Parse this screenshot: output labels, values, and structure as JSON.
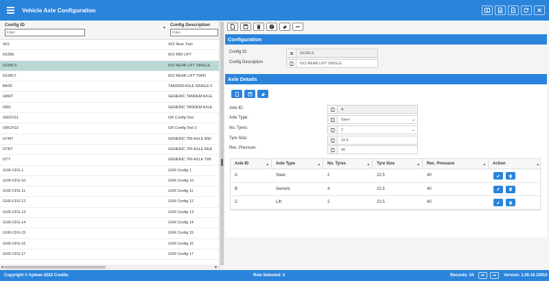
{
  "header": {
    "title": "Vehicle Axle Configuration",
    "tools": [
      "window-icon",
      "document-icon",
      "export-icon",
      "refresh-icon",
      "close-icon"
    ]
  },
  "grid": {
    "columns": [
      {
        "label": "Config ID",
        "filter_placeholder": "Filter"
      },
      {
        "label": "Config Description",
        "filter_placeholder": "Filter"
      }
    ],
    "rows": [
      {
        "id": "4X2",
        "desc": "4X2 Rear Twin"
      },
      {
        "id": "6X2ML",
        "desc": "6X2 MID LIFT"
      },
      {
        "id": "6X2RLS",
        "desc": "6X2 REAR LIFT SINGLE"
      },
      {
        "id": "6X2RLT",
        "desc": "6X2 REAR LIFT TWIN"
      },
      {
        "id": "BASF",
        "desc": "TANDEM AXLE SINGLE F"
      },
      {
        "id": "GBRT",
        "desc": "GENERIC TANDEM AXLE"
      },
      {
        "id": "GBS",
        "desc": "GENERIC TANDEM AXLE"
      },
      {
        "id": "GRCFG1",
        "desc": "GR Config Test"
      },
      {
        "id": "GRCFG2",
        "desc": "GR Config Test 2"
      },
      {
        "id": "GTMT",
        "desc": "GENERIC TRI-AXLE MID"
      },
      {
        "id": "GTRT",
        "desc": "GENERIC TRI-AXLE REA"
      },
      {
        "id": "GTT",
        "desc": "GENERIC TRI-AXLE TWI"
      },
      {
        "id": "GXR-CFG-1",
        "desc": "GXR Config 1"
      },
      {
        "id": "GXR-CFG-10",
        "desc": "GXR Config 10"
      },
      {
        "id": "GXR-CFG-11",
        "desc": "GXR Config 11"
      },
      {
        "id": "GXR-CFG-12",
        "desc": "GXR Config 12"
      },
      {
        "id": "GXR-CFG-13",
        "desc": "GXR Config 13"
      },
      {
        "id": "GXR-CFG-14",
        "desc": "GXR Config 14"
      },
      {
        "id": "GXR-CFG-15",
        "desc": "GXR Config 15"
      },
      {
        "id": "GXR-CFG-16",
        "desc": "GXR Config 16"
      },
      {
        "id": "GXR-CFG-17",
        "desc": "GXR Config 17"
      }
    ],
    "selected_row": "6X2RLS"
  },
  "toolbar": [
    "new-icon",
    "save-icon",
    "delete-icon",
    "help-icon",
    "eraser-icon",
    "minus-icon"
  ],
  "configuration": {
    "section_title": "Configuration",
    "config_id_label": "Config ID:",
    "config_id_value": "6X2RLS",
    "config_desc_label": "Config Description",
    "config_desc_value": "6X2 REAR LIFT SINGLE"
  },
  "axle": {
    "section_title": "Axle Details",
    "axle_id_label": "Axle ID:",
    "axle_id_value": "A",
    "axle_type_label": "Axle Type:",
    "axle_type_value": "Steer",
    "no_tyres_label": "No. Tyres:",
    "no_tyres_value": "2",
    "tyre_size_label": "Tyre Size:",
    "tyre_size_value": "22.5",
    "rec_pressure_label": "Rec. Pressure:",
    "rec_pressure_value": "40"
  },
  "axle_table": {
    "headers": [
      "Axle ID",
      "Axle Type",
      "No. Tyres",
      "Tyre Size",
      "Rec. Pressure",
      "Action"
    ],
    "rows": [
      {
        "axle_id": "A",
        "type": "Steer",
        "tyres": "2",
        "size": "22.5",
        "pressure": "40"
      },
      {
        "axle_id": "B",
        "type": "Generic",
        "tyres": "4",
        "size": "22.5",
        "pressure": "40"
      },
      {
        "axle_id": "C",
        "type": "Lift",
        "tyres": "2",
        "size": "22.5",
        "pressure": "40"
      }
    ]
  },
  "footer": {
    "copyright": "Copyright © Aptean 2022 Credits",
    "row_selected": "Row Selected: 3",
    "records": "Records: 34",
    "version": "Version: 1.00.16.10910"
  },
  "colors": {
    "brand": "#2a84dc",
    "selected_row": "#b9d8d6"
  }
}
